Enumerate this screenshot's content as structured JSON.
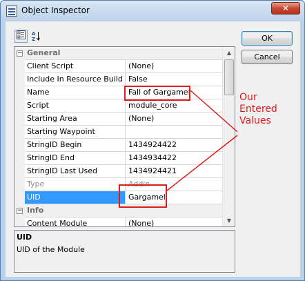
{
  "window": {
    "title": "Object Inspector",
    "close_glyph": "✕"
  },
  "toolbar": {
    "categorized_icon": "categorized-view-icon",
    "alphabetical_icon": "sort-alpha-icon",
    "alphabetical_glyph": "A↓Z"
  },
  "grid": {
    "categories": [
      {
        "name": "General",
        "expanded": true,
        "toggle": "−"
      },
      {
        "name": "Info",
        "expanded": true,
        "toggle": "−"
      }
    ],
    "properties": [
      {
        "name": "Client Script",
        "value": "(None)"
      },
      {
        "name": "Include In Resource Build",
        "value": "False"
      },
      {
        "name": "Name",
        "value": "Fall of Gargamel"
      },
      {
        "name": "Script",
        "value": "module_core"
      },
      {
        "name": "Starting Area",
        "value": "(None)"
      },
      {
        "name": "Starting Waypoint",
        "value": ""
      },
      {
        "name": "StringID Begin",
        "value": "1434924422"
      },
      {
        "name": "StringID End",
        "value": "1434934422"
      },
      {
        "name": "StringID Last Used",
        "value": "1434924421"
      },
      {
        "name": "Type",
        "value": "Addin"
      },
      {
        "name": "UID",
        "value": "Gargamel"
      }
    ],
    "info_properties": [
      {
        "name": "Content Module",
        "value": "(None)"
      }
    ],
    "selected": "UID"
  },
  "description": {
    "title": "UID",
    "text": "UID of the Module"
  },
  "buttons": {
    "ok": "OK",
    "cancel": "Cancel"
  },
  "annotation": {
    "line1": "Our",
    "line2": "Entered",
    "line3": "Values",
    "color": "#e01b1b"
  }
}
